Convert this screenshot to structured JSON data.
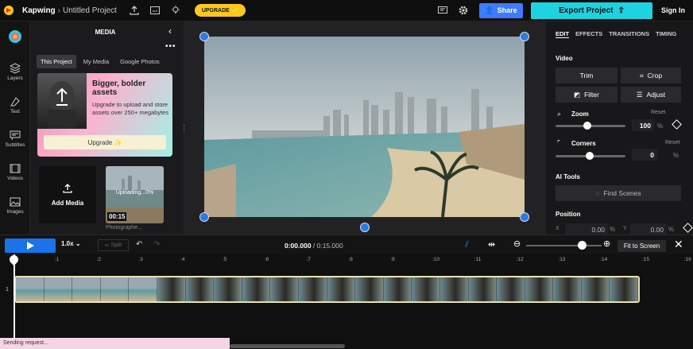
{
  "topbar": {
    "brand": "Kapwing",
    "separator": "›",
    "project": "Untitled Project",
    "upgrade_label": "UPGRADE ✨",
    "share_label": "Share",
    "export_label": "Export Project",
    "signin_label": "Sign In"
  },
  "rail": {
    "items": [
      {
        "label": "Layers",
        "icon": "layers-icon"
      },
      {
        "label": "Text",
        "icon": "text-icon"
      },
      {
        "label": "Subtitles",
        "icon": "subtitles-icon"
      },
      {
        "label": "Videos",
        "icon": "videos-icon"
      },
      {
        "label": "Images",
        "icon": "images-icon"
      }
    ]
  },
  "media": {
    "title": "MEDIA",
    "tabs": [
      "This Project",
      "My Media",
      "Google Photos"
    ],
    "promo": {
      "title": "Bigger, bolder assets",
      "text": "Upgrade to upload and store assets over 250+ megabytes",
      "button": "Upgrade ✨"
    },
    "add_media_label": "Add Media",
    "item": {
      "status": "Uploading...0%",
      "duration": "00:15",
      "caption": "Photographe..."
    }
  },
  "right_panel": {
    "tabs": [
      "EDIT",
      "EFFECTS",
      "TRANSITIONS",
      "TIMING"
    ],
    "video_label": "Video",
    "trim_label": "Trim",
    "crop_label": "Crop",
    "filter_label": "Filter",
    "adjust_label": "Adjust",
    "zoom_label": "Zoom",
    "zoom_value": "100",
    "zoom_unit": "%",
    "zoom_level": 0.45,
    "corners_label": "Corners",
    "corners_value": "0",
    "corners_unit": "%",
    "reset_label": "Reset",
    "ai_tools_label": "AI Tools",
    "find_scenes_label": "Find Scenes",
    "position_label": "Position",
    "pos_x_label": "X",
    "pos_x_value": "0.00",
    "pos_y_label": "Y",
    "pos_y_value": "0.00",
    "pos_unit": "%"
  },
  "timeline": {
    "speed": "1.0x",
    "split_label": "Split",
    "current_time": "0:00.000",
    "time_sep": " / ",
    "total_time": "0:15.000",
    "fit_label": "Fit to Screen",
    "track_number": "1",
    "ruler_ticks": [
      "0",
      ":1",
      ":2",
      ":3",
      ":4",
      ":5",
      ":6",
      ":7",
      ":8",
      ":9",
      ":10",
      ":11",
      ":12",
      ":13",
      ":14",
      ":15",
      ":16"
    ]
  },
  "status_text": "Sending request...",
  "colors": {
    "accent_blue": "#2c7be5",
    "export": "#1fd2e0",
    "upgrade": "#ffc81e"
  }
}
